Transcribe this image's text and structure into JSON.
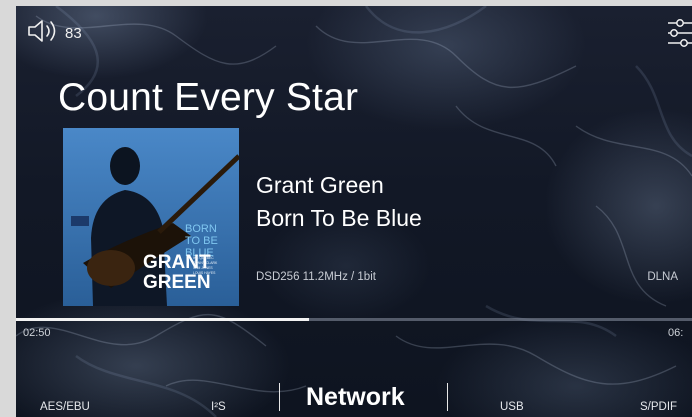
{
  "volume": {
    "level": "83",
    "icon": "speaker-icon"
  },
  "settings": {
    "icon": "sliders-icon"
  },
  "now_playing": {
    "title": "Count Every Star",
    "artist": "Grant Green",
    "album": "Born To Be Blue",
    "format": "DSD256  11.2MHz / 1bit",
    "source": "DLNA"
  },
  "album_art": {
    "text_born": "BORN",
    "text_to_be": "TO BE",
    "text_blue": "BLUE",
    "text_grant": "GRANT",
    "text_green": "GREEN",
    "credits": [
      "IKE QUEBEC",
      "SONNY CLARK",
      "SAM JONES",
      "LOUIS HAYES"
    ],
    "bg_color": "#3a78b8"
  },
  "playback": {
    "elapsed": "02:50",
    "total": "06:",
    "progress": 0.434
  },
  "inputs": [
    {
      "label": "AES/EBU"
    },
    {
      "label": "I²S"
    },
    {
      "label": "Network",
      "active": true
    },
    {
      "label": "USB"
    },
    {
      "label": "S/PDIF"
    }
  ],
  "colors": {
    "accent": "#ffffff",
    "muted": "#c8ccd4"
  }
}
